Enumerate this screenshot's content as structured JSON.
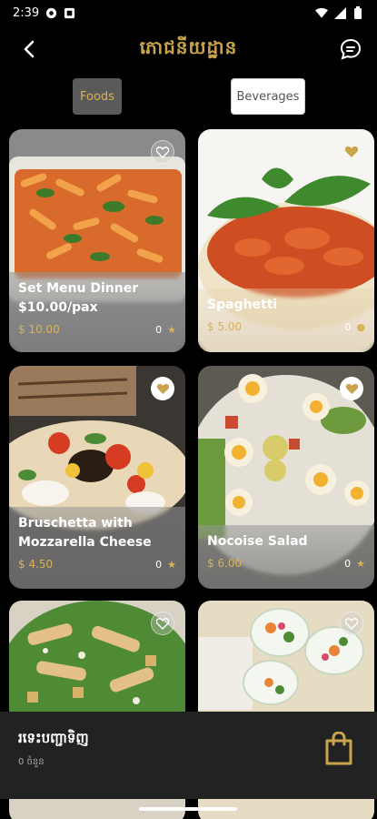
{
  "status": {
    "time": "2:39"
  },
  "header": {
    "title": "ភោជនីយដ្ឋាន"
  },
  "tabs": [
    {
      "label": "Foods"
    },
    {
      "label": "Beverages"
    }
  ],
  "items": [
    {
      "name": "Set Menu Dinner",
      "subtitle": "$10.00/pax",
      "price": "$ 10.00",
      "rating": "0"
    },
    {
      "name": "Spaghetti",
      "subtitle": "",
      "price": "$ 5.00",
      "rating": "0"
    },
    {
      "name": "Bruschetta with Mozzarella Cheese",
      "subtitle": "",
      "price": "$ 4.50",
      "rating": "0"
    },
    {
      "name": "Nocoise Salad",
      "subtitle": "",
      "price": "$ 6.00",
      "rating": "0"
    },
    {
      "name": "",
      "subtitle": "",
      "price": "",
      "rating": ""
    },
    {
      "name": "",
      "subtitle": "",
      "price": "",
      "rating": ""
    }
  ],
  "cart": {
    "title": "រទេះបញ្ជាទិញ",
    "count": "0 ចំនួន"
  },
  "colors": {
    "accent": "#c9a44c",
    "background": "#000000",
    "bottom_bar": "#222222"
  },
  "icons": {
    "back": "arrow-left-icon",
    "chat": "chat-bubble-icon",
    "favorite": "heart-icon",
    "star": "star-icon",
    "cart": "shopping-bag-icon"
  }
}
